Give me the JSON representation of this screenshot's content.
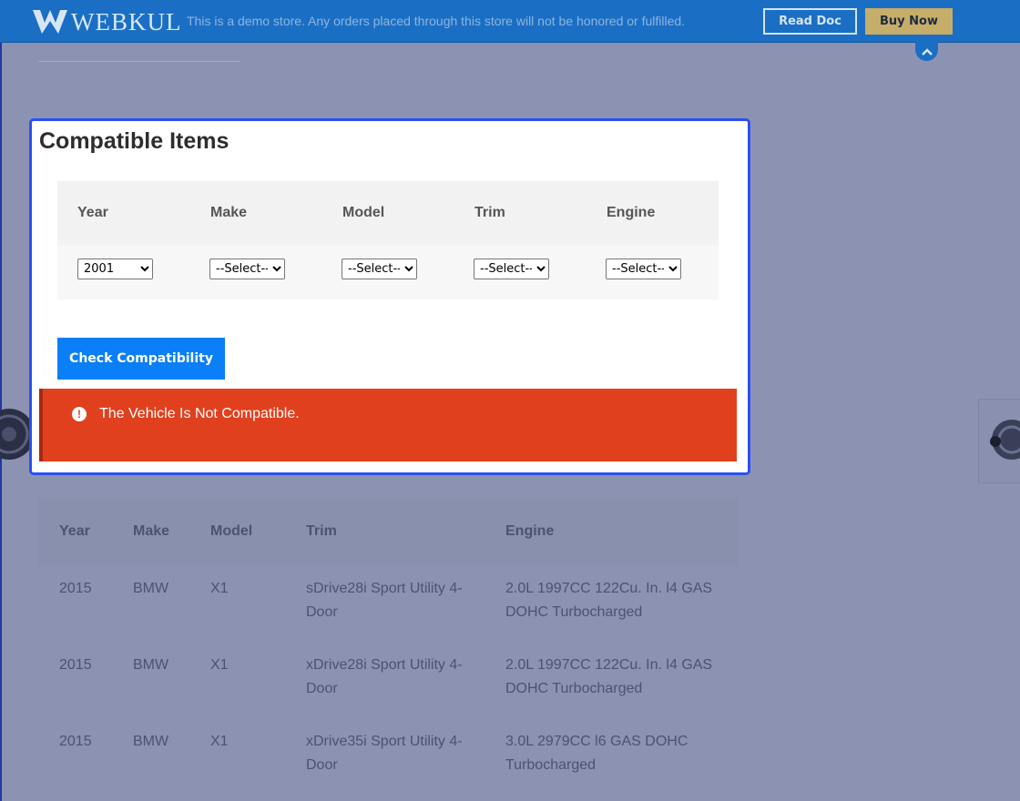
{
  "banner": {
    "brand": "WEBKUL",
    "notice": "This is a demo store. Any orders placed through this store will not be honored or fulfilled.",
    "read_doc_label": "Read Doc",
    "buy_now_label": "Buy Now"
  },
  "modal": {
    "title": "Compatible Items",
    "filters": {
      "year": {
        "label": "Year",
        "value": "2001"
      },
      "make": {
        "label": "Make",
        "value": "--Select--"
      },
      "model": {
        "label": "Model",
        "value": "--Select--"
      },
      "trim": {
        "label": "Trim",
        "value": "--Select--"
      },
      "engine": {
        "label": "Engine",
        "value": "--Select--"
      }
    },
    "check_button_label": "Check Compatibility",
    "alert": {
      "message": "The Vehicle Is Not Compatible.",
      "icon": "exclamation-circle-icon",
      "color": "#e1401e"
    }
  },
  "compat_table": {
    "headers": [
      "Year",
      "Make",
      "Model",
      "Trim",
      "Engine"
    ],
    "rows": [
      [
        "2015",
        "BMW",
        "X1",
        "sDrive28i Sport Utility 4-Door",
        "2.0L 1997CC 122Cu. In. l4 GAS DOHC Turbocharged"
      ],
      [
        "2015",
        "BMW",
        "X1",
        "xDrive28i Sport Utility 4-Door",
        "2.0L 1997CC 122Cu. In. l4 GAS DOHC Turbocharged"
      ],
      [
        "2015",
        "BMW",
        "X1",
        "xDrive35i Sport Utility 4-Door",
        "3.0L 2979CC l6 GAS DOHC Turbocharged"
      ]
    ]
  },
  "colors": {
    "banner": "#1a6fc4",
    "modal_border": "#2b4ff0",
    "primary_button": "#0a7ff7",
    "buy_now": "#c7ad6a",
    "overlay": "#8c93b2"
  }
}
